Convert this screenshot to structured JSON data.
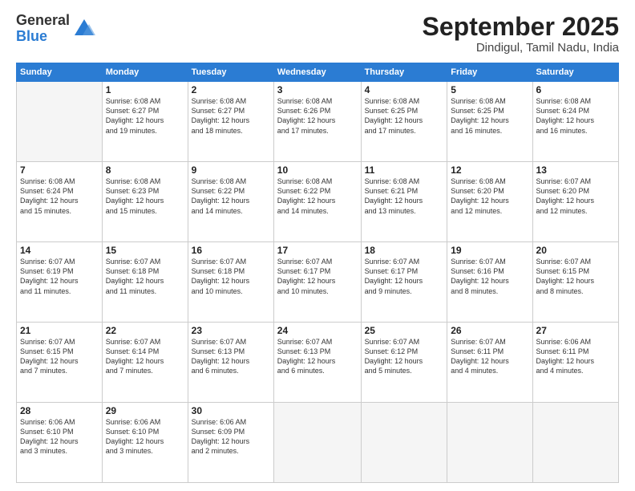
{
  "logo": {
    "general": "General",
    "blue": "Blue"
  },
  "title": "September 2025",
  "location": "Dindigul, Tamil Nadu, India",
  "days_header": [
    "Sunday",
    "Monday",
    "Tuesday",
    "Wednesday",
    "Thursday",
    "Friday",
    "Saturday"
  ],
  "weeks": [
    [
      {
        "num": "",
        "info": ""
      },
      {
        "num": "1",
        "info": "Sunrise: 6:08 AM\nSunset: 6:27 PM\nDaylight: 12 hours\nand 19 minutes."
      },
      {
        "num": "2",
        "info": "Sunrise: 6:08 AM\nSunset: 6:27 PM\nDaylight: 12 hours\nand 18 minutes."
      },
      {
        "num": "3",
        "info": "Sunrise: 6:08 AM\nSunset: 6:26 PM\nDaylight: 12 hours\nand 17 minutes."
      },
      {
        "num": "4",
        "info": "Sunrise: 6:08 AM\nSunset: 6:25 PM\nDaylight: 12 hours\nand 17 minutes."
      },
      {
        "num": "5",
        "info": "Sunrise: 6:08 AM\nSunset: 6:25 PM\nDaylight: 12 hours\nand 16 minutes."
      },
      {
        "num": "6",
        "info": "Sunrise: 6:08 AM\nSunset: 6:24 PM\nDaylight: 12 hours\nand 16 minutes."
      }
    ],
    [
      {
        "num": "7",
        "info": "Sunrise: 6:08 AM\nSunset: 6:24 PM\nDaylight: 12 hours\nand 15 minutes."
      },
      {
        "num": "8",
        "info": "Sunrise: 6:08 AM\nSunset: 6:23 PM\nDaylight: 12 hours\nand 15 minutes."
      },
      {
        "num": "9",
        "info": "Sunrise: 6:08 AM\nSunset: 6:22 PM\nDaylight: 12 hours\nand 14 minutes."
      },
      {
        "num": "10",
        "info": "Sunrise: 6:08 AM\nSunset: 6:22 PM\nDaylight: 12 hours\nand 14 minutes."
      },
      {
        "num": "11",
        "info": "Sunrise: 6:08 AM\nSunset: 6:21 PM\nDaylight: 12 hours\nand 13 minutes."
      },
      {
        "num": "12",
        "info": "Sunrise: 6:08 AM\nSunset: 6:20 PM\nDaylight: 12 hours\nand 12 minutes."
      },
      {
        "num": "13",
        "info": "Sunrise: 6:07 AM\nSunset: 6:20 PM\nDaylight: 12 hours\nand 12 minutes."
      }
    ],
    [
      {
        "num": "14",
        "info": "Sunrise: 6:07 AM\nSunset: 6:19 PM\nDaylight: 12 hours\nand 11 minutes."
      },
      {
        "num": "15",
        "info": "Sunrise: 6:07 AM\nSunset: 6:18 PM\nDaylight: 12 hours\nand 11 minutes."
      },
      {
        "num": "16",
        "info": "Sunrise: 6:07 AM\nSunset: 6:18 PM\nDaylight: 12 hours\nand 10 minutes."
      },
      {
        "num": "17",
        "info": "Sunrise: 6:07 AM\nSunset: 6:17 PM\nDaylight: 12 hours\nand 10 minutes."
      },
      {
        "num": "18",
        "info": "Sunrise: 6:07 AM\nSunset: 6:17 PM\nDaylight: 12 hours\nand 9 minutes."
      },
      {
        "num": "19",
        "info": "Sunrise: 6:07 AM\nSunset: 6:16 PM\nDaylight: 12 hours\nand 8 minutes."
      },
      {
        "num": "20",
        "info": "Sunrise: 6:07 AM\nSunset: 6:15 PM\nDaylight: 12 hours\nand 8 minutes."
      }
    ],
    [
      {
        "num": "21",
        "info": "Sunrise: 6:07 AM\nSunset: 6:15 PM\nDaylight: 12 hours\nand 7 minutes."
      },
      {
        "num": "22",
        "info": "Sunrise: 6:07 AM\nSunset: 6:14 PM\nDaylight: 12 hours\nand 7 minutes."
      },
      {
        "num": "23",
        "info": "Sunrise: 6:07 AM\nSunset: 6:13 PM\nDaylight: 12 hours\nand 6 minutes."
      },
      {
        "num": "24",
        "info": "Sunrise: 6:07 AM\nSunset: 6:13 PM\nDaylight: 12 hours\nand 6 minutes."
      },
      {
        "num": "25",
        "info": "Sunrise: 6:07 AM\nSunset: 6:12 PM\nDaylight: 12 hours\nand 5 minutes."
      },
      {
        "num": "26",
        "info": "Sunrise: 6:07 AM\nSunset: 6:11 PM\nDaylight: 12 hours\nand 4 minutes."
      },
      {
        "num": "27",
        "info": "Sunrise: 6:06 AM\nSunset: 6:11 PM\nDaylight: 12 hours\nand 4 minutes."
      }
    ],
    [
      {
        "num": "28",
        "info": "Sunrise: 6:06 AM\nSunset: 6:10 PM\nDaylight: 12 hours\nand 3 minutes."
      },
      {
        "num": "29",
        "info": "Sunrise: 6:06 AM\nSunset: 6:10 PM\nDaylight: 12 hours\nand 3 minutes."
      },
      {
        "num": "30",
        "info": "Sunrise: 6:06 AM\nSunset: 6:09 PM\nDaylight: 12 hours\nand 2 minutes."
      },
      {
        "num": "",
        "info": ""
      },
      {
        "num": "",
        "info": ""
      },
      {
        "num": "",
        "info": ""
      },
      {
        "num": "",
        "info": ""
      }
    ]
  ]
}
